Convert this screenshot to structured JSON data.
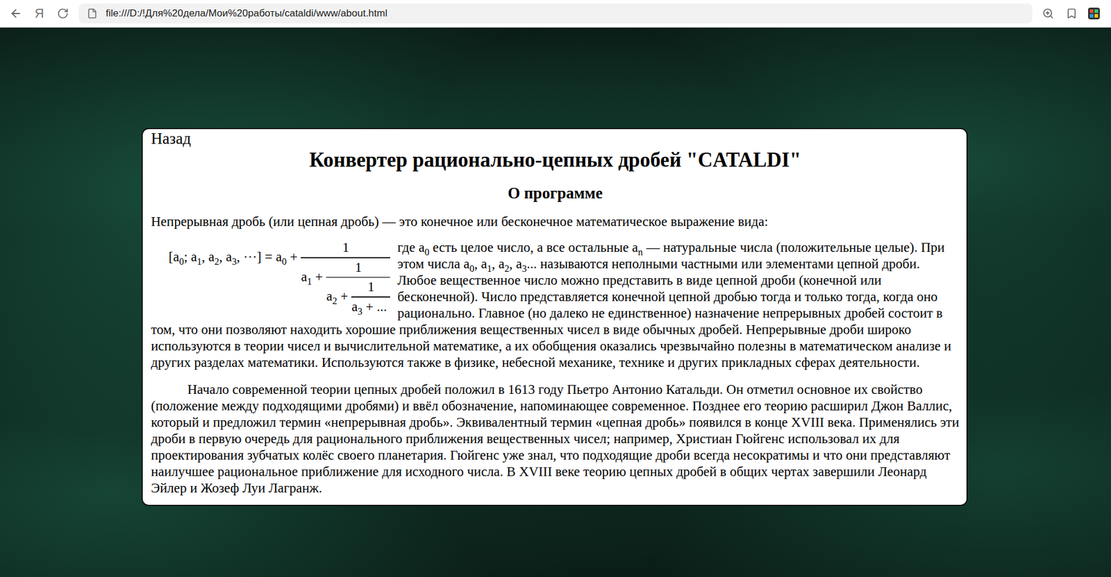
{
  "browser": {
    "brand": "Я",
    "address": "file:///D:/!Для%20дела/Мои%20работы/cataldi/www/about.html"
  },
  "page": {
    "back_link": "Назад",
    "title": "Конвертер рационально-цепных дробей \"CATALDI\"",
    "subtitle": "О программе",
    "intro": "Непрерывная дробь (или цепная дробь) — это конечное или бесконечное математическое выражение вида:",
    "formula": {
      "lhs": [
        {
          "text": "[a",
          "sub": "0"
        },
        {
          "text": "; a",
          "sub": "1"
        },
        {
          "text": ", a",
          "sub": "2"
        },
        {
          "text": ", a",
          "sub": "3"
        },
        {
          "text": ", ···] = a",
          "sub": "0"
        },
        {
          "text": " +"
        }
      ],
      "levels": [
        {
          "numerator": "1",
          "text": "a",
          "sub": "1",
          "op": " +"
        },
        {
          "numerator": "1",
          "text": "a",
          "sub": "2",
          "op": " +"
        },
        {
          "numerator": "1",
          "text": "a",
          "sub": "3",
          "op": " + ..."
        }
      ]
    },
    "paragraph1": [
      {
        "text": "где a",
        "sub": "0"
      },
      {
        "text": " есть целое число, а все остальные a",
        "sub": "n"
      },
      {
        "text": " — натуральные числа (положительные целые). При этом числа a",
        "sub": "0"
      },
      {
        "text": ", a",
        "sub": "1"
      },
      {
        "text": ", a",
        "sub": "2"
      },
      {
        "text": ", a",
        "sub": "3"
      },
      {
        "text": "... называются неполными частными или элементами цепной дроби. Любое вещественное число можно представить в виде цепной дроби (конечной или бесконечной). Число представляется конечной цепной дробью тогда и только тогда, когда оно рационально. Главное (но далеко не единственное) назначение непрерывных дробей состоит в том, что они позволяют находить хорошие приближения вещественных чисел в виде обычных дробей. Непрерывные дроби широко используются в теории чисел и вычислительной математике, а их обобщения оказались чрезвычайно полезны в математическом анализе и других разделах математики. Используются также в физике, небесной механике, технике и других прикладных сферах деятельности."
      }
    ],
    "paragraph2": "Начало современной теории цепных дробей положил в 1613 году Пьетро Антонио Катальди. Он отметил основное их свойство (положение между подходящими дробями) и ввёл обозначение, напоминающее современное. Позднее его теорию расширил Джон Валлис, который и предложил термин «непрерывная дробь». Эквивалентный термин «цепная дробь» появился в конце XVIII века. Применялись эти дроби в первую очередь для рационального приближения вещественных чисел; например, Христиан Гюйгенс использовал их для проектирования зубчатых колёс своего планетария. Гюйгенс уже знал, что подходящие дроби всегда несократимы и что они представляют наилучшее рациональное приближение для исходного числа. В XVIII веке теорию цепных дробей в общих чертах завершили Леонард Эйлер и Жозеф Луи Лагранж."
  }
}
